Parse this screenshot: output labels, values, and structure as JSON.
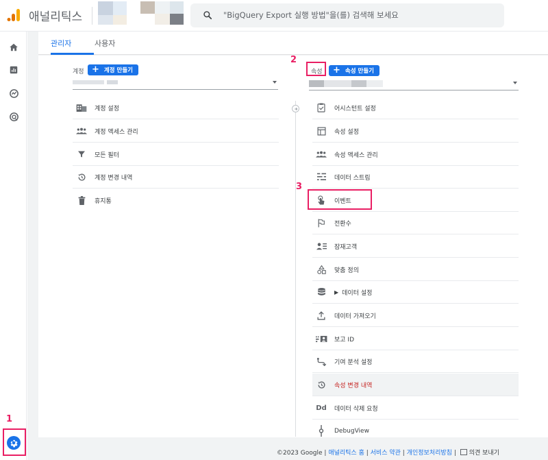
{
  "header": {
    "app_title": "애널리틱스",
    "search_placeholder": "\"BigQuery Export 실행 방법\"을(를) 검색해 보세요"
  },
  "tabs": [
    {
      "label": "관리자",
      "active": true
    },
    {
      "label": "사용자",
      "active": false
    }
  ],
  "account_column": {
    "label": "계정",
    "create_button": "계정 만들기",
    "items": [
      {
        "label": "계정 설정",
        "icon": "building-icon"
      },
      {
        "label": "계정 액세스 관리",
        "icon": "people-icon"
      },
      {
        "label": "모든 필터",
        "icon": "filter-icon"
      },
      {
        "label": "계정 변경 내역",
        "icon": "history-icon"
      },
      {
        "label": "휴지통",
        "icon": "trash-icon"
      }
    ]
  },
  "property_column": {
    "label": "속성",
    "create_button": "속성 만들기",
    "items": [
      {
        "label": "어시스턴트 설정",
        "icon": "checklist-icon"
      },
      {
        "label": "속성 설정",
        "icon": "window-icon"
      },
      {
        "label": "속성 액세스 관리",
        "icon": "people-icon"
      },
      {
        "label": "데이터 스트림",
        "icon": "stream-icon"
      },
      {
        "label": "이벤트",
        "icon": "touch-icon"
      },
      {
        "label": "전환수",
        "icon": "flag-icon"
      },
      {
        "label": "잠재고객",
        "icon": "audience-icon"
      },
      {
        "label": "맞춤 정의",
        "icon": "shapes-icon"
      },
      {
        "label": "데이터 설정",
        "icon": "database-icon",
        "expandable": true
      },
      {
        "label": "데이터 가져오기",
        "icon": "upload-icon"
      },
      {
        "label": "보고 ID",
        "icon": "id-icon"
      },
      {
        "label": "기여 분석 설정",
        "icon": "attribution-icon"
      },
      {
        "label": "속성 변경 내역",
        "icon": "history-icon",
        "highlighted": true
      },
      {
        "label": "데이터 삭제 요청",
        "icon": "dd-icon"
      },
      {
        "label": "DebugView",
        "icon": "debug-icon"
      }
    ]
  },
  "annotations": {
    "marker_1": "1",
    "marker_2": "2",
    "marker_3": "3"
  },
  "footer": {
    "copyright": "©2023 Google",
    "sep": "|",
    "link_home": "애널리틱스 홈",
    "link_terms": "서비스 약관",
    "link_privacy": "개인정보처리방침",
    "feedback": "의견 보내기"
  },
  "colors": {
    "accent": "#1a73e8",
    "annotation": "#e91e63",
    "highlight_text": "#c5221f"
  }
}
